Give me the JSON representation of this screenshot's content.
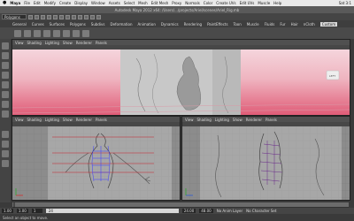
{
  "menubar": {
    "app": "Maya",
    "items": [
      "File",
      "Edit",
      "Modify",
      "Create",
      "Display",
      "Window",
      "Assets",
      "Select",
      "Mesh",
      "Edit Mesh",
      "Proxy",
      "Normals",
      "Color",
      "Create UVs",
      "Edit UVs",
      "Muscle",
      "Help"
    ],
    "clock": "Sat 3:1"
  },
  "window": {
    "title": "Autodesk Maya 2012 x64: /Users/.../projects/Ariel/scenes/Ariel_Rig.mb"
  },
  "status": {
    "menu_set": "Polygons"
  },
  "shelf": {
    "tabs": [
      "General",
      "Curves",
      "Surfaces",
      "Polygons",
      "Subdivs",
      "Deformation",
      "Animation",
      "Dynamics",
      "Rendering",
      "PaintEffects",
      "Toon",
      "Muscle",
      "Fluids",
      "Fur",
      "Hair",
      "nCloth",
      "Custom"
    ],
    "active_tab": "Custom"
  },
  "viewports": {
    "menu": [
      "View",
      "Shading",
      "Lighting",
      "Show",
      "Renderer",
      "Panels"
    ],
    "persp_label": "persp"
  },
  "timeline": {
    "start_frame": "1.00",
    "current_frame": "1.00",
    "range_start": "1",
    "range_end": "24",
    "end_a": "24.00",
    "end_b": "48.00",
    "anim_layer": "No Anim Layer",
    "char_set": "No Character Set"
  },
  "cmdline": {
    "help_text": "Select an object to move."
  },
  "colors": {
    "viewport_gradient_top": "#f5d5dc",
    "viewport_gradient_bottom": "#e05c77",
    "accent": "#c8202a"
  },
  "icons": {
    "apple": "",
    "select": "arrow-icon",
    "move": "move-icon",
    "rotate": "rotate-icon",
    "scale": "scale-icon"
  }
}
